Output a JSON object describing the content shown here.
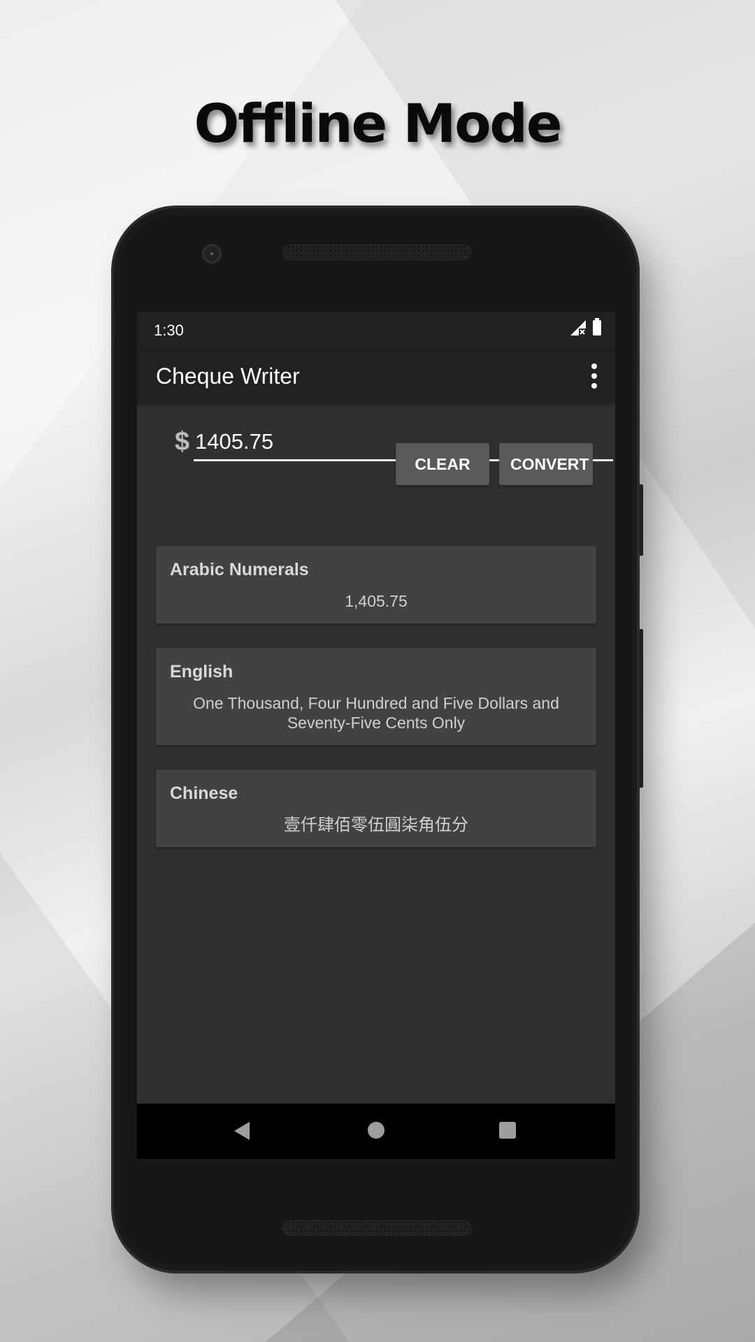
{
  "headline": "Offline Mode",
  "status_bar": {
    "time": "1:30",
    "icons": [
      "signal-no-data-icon",
      "battery-full-icon"
    ]
  },
  "app_bar": {
    "title": "Cheque Writer",
    "overflow_icon": "more-vert-icon"
  },
  "amount_input": {
    "currency_symbol": "$",
    "value": "1405.75"
  },
  "buttons": {
    "clear": "CLEAR",
    "convert": "CONVERT"
  },
  "results": [
    {
      "title": "Arabic Numerals",
      "value": "1,405.75"
    },
    {
      "title": "English",
      "value": "One Thousand, Four Hundred and Five Dollars and Seventy-Five Cents Only"
    },
    {
      "title": "Chinese",
      "value": "壹仟肆佰零伍圓柒角伍分"
    }
  ],
  "nav_bar": {
    "back": "back-icon",
    "home": "home-icon",
    "recents": "recents-icon"
  },
  "colors": {
    "app_bar": "#212121",
    "screen_background": "#303030",
    "card_background": "#424242",
    "button_background": "#595959",
    "nav_bar": "#000000"
  }
}
